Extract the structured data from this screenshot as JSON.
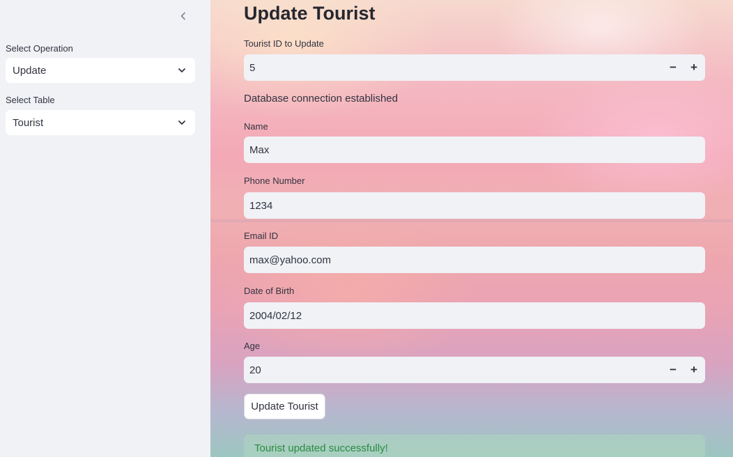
{
  "sidebar": {
    "operation_label": "Select Operation",
    "operation_value": "Update",
    "table_label": "Select Table",
    "table_value": "Tourist"
  },
  "main": {
    "title": "Update Tourist",
    "tourist_id_label": "Tourist ID to Update",
    "tourist_id_value": "5",
    "connection_status": "Database connection established",
    "name_label": "Name",
    "name_value": "Max",
    "phone_label": "Phone Number",
    "phone_value": "1234",
    "email_label": "Email ID",
    "email_value": "max@yahoo.com",
    "dob_label": "Date of Birth",
    "dob_value": "2004/02/12",
    "age_label": "Age",
    "age_value": "20",
    "submit_label": "Update Tourist",
    "success_message": "Tourist updated successfully!",
    "stepper_minus": "−",
    "stepper_plus": "+"
  },
  "colors": {
    "sidebar_bg": "#f0f2f6",
    "input_bg": "#f0f2f6",
    "text": "#31333f",
    "success_text": "#2b8a43"
  },
  "icons": {
    "collapse": "chevron-left-icon",
    "dropdown": "chevron-down-icon"
  }
}
